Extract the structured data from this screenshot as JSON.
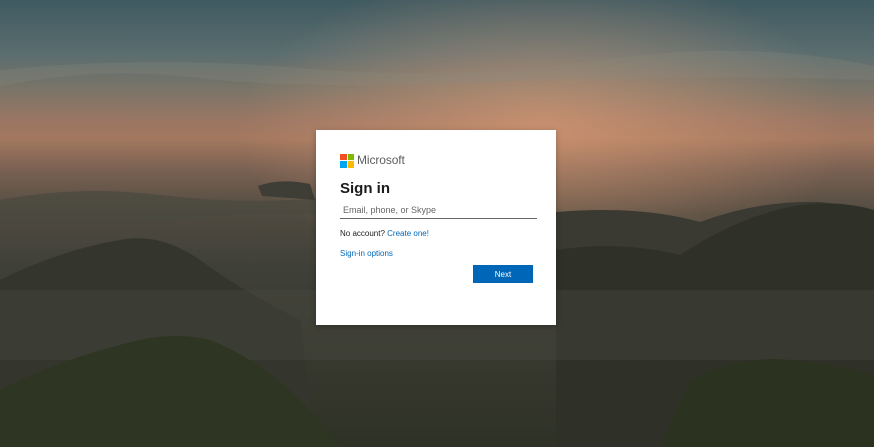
{
  "brand": {
    "name": "Microsoft",
    "logo_colors": [
      "#f25022",
      "#7fba00",
      "#00a4ef",
      "#ffb900"
    ]
  },
  "signin": {
    "title": "Sign in",
    "email_placeholder": "Email, phone, or Skype",
    "email_value": "",
    "no_account_text": "No account?",
    "create_link": "Create one!",
    "options_link": "Sign-in options",
    "next_button": "Next"
  },
  "theme": {
    "accent": "#0067b8",
    "card_background": "#ffffff",
    "text": "#1b1b1b"
  }
}
